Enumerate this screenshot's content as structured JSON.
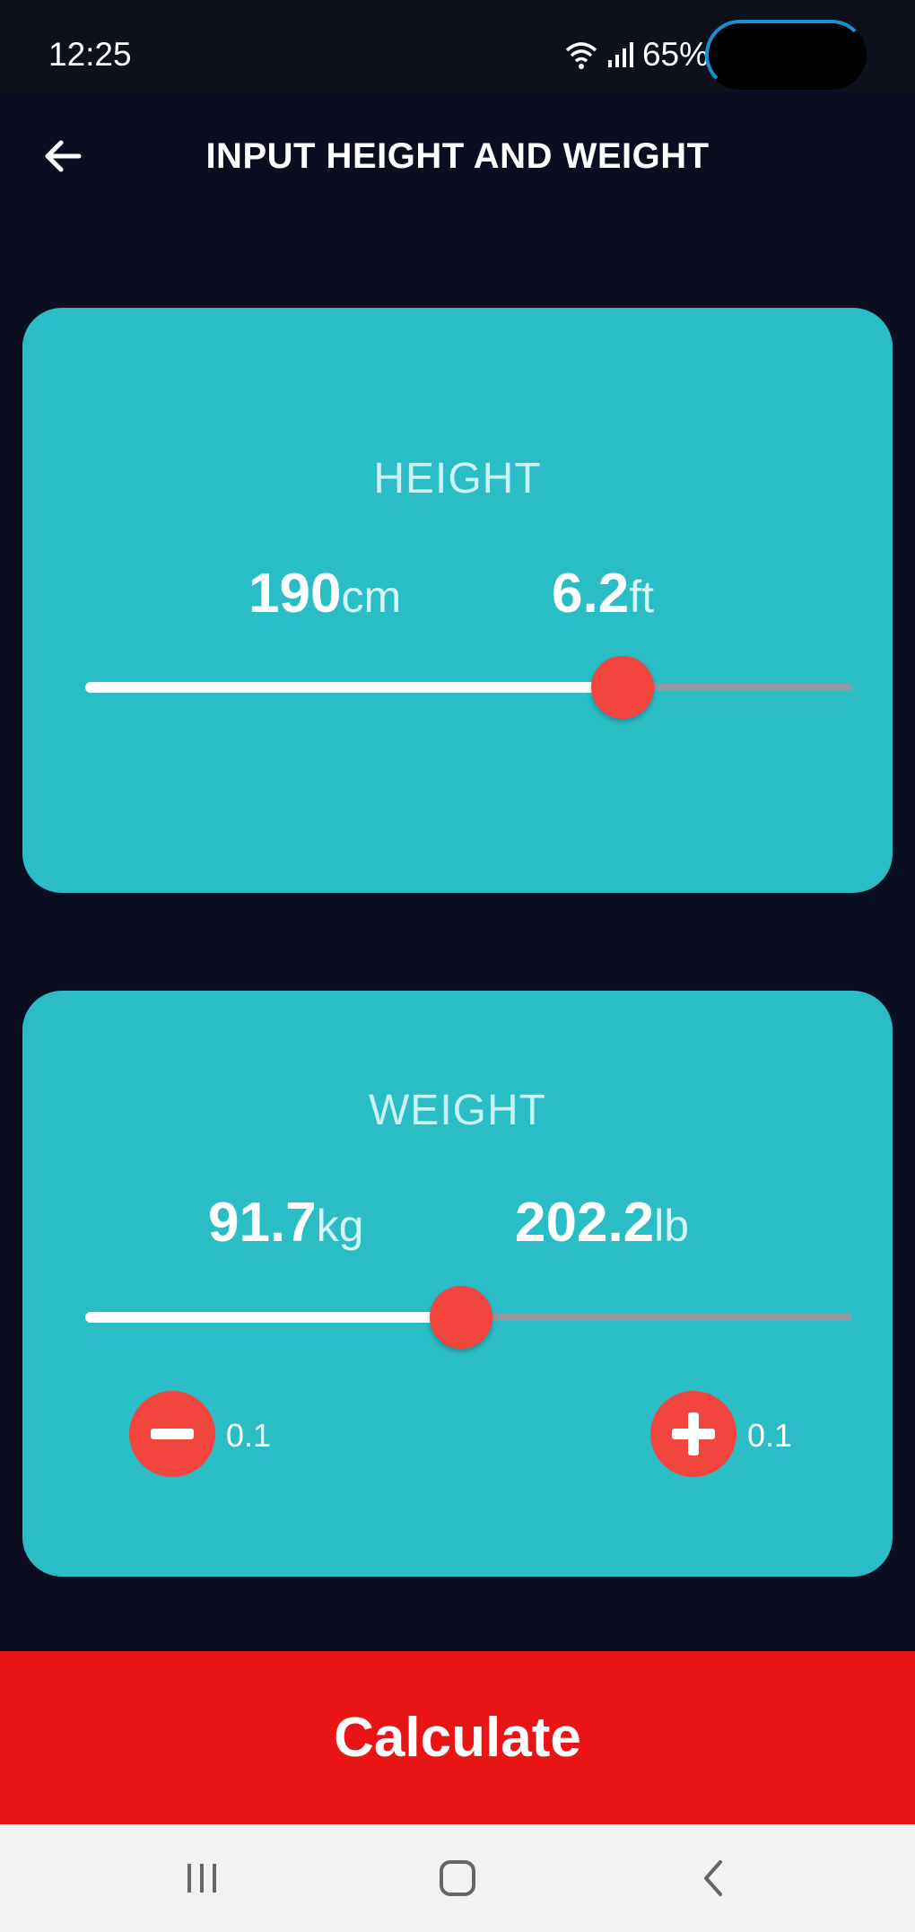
{
  "status_bar": {
    "time": "12:25",
    "battery": "65%"
  },
  "header": {
    "title": "INPUT HEIGHT AND WEIGHT"
  },
  "height_card": {
    "label": "HEIGHT",
    "metric_value": "190",
    "metric_unit": "cm",
    "imperial_value": "6.2",
    "imperial_unit": "ft",
    "slider_fraction": 0.7
  },
  "weight_card": {
    "label": "WEIGHT",
    "metric_value": "91.7",
    "metric_unit": "kg",
    "imperial_value": "202.2",
    "imperial_unit": "lb",
    "slider_fraction": 0.49,
    "decrement_label": "0.1",
    "increment_label": "0.1"
  },
  "actions": {
    "calculate_label": "Calculate"
  },
  "colors": {
    "background": "#0a0e20",
    "card": "#2abdc6",
    "accent": "#f2453d",
    "calculate": "#e91515"
  }
}
